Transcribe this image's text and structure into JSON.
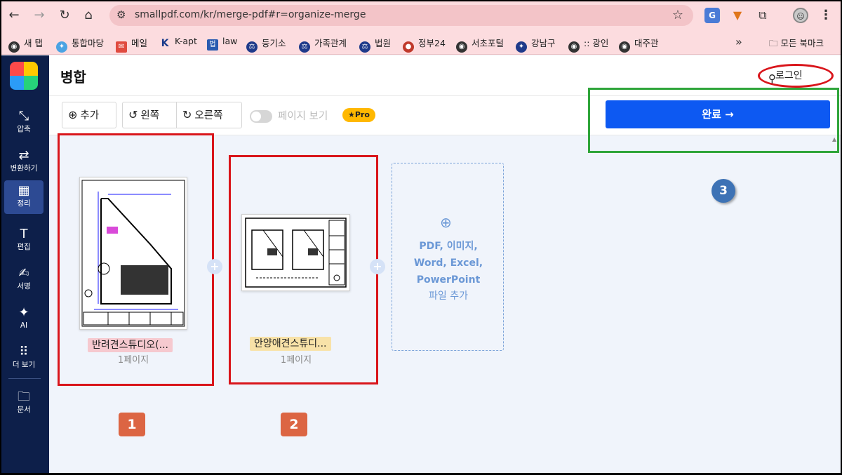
{
  "browser": {
    "url": "smallpdf.com/kr/merge-pdf#r=organize-merge",
    "bookmarks": [
      "새 탭",
      "통합마당",
      "메일",
      "K-apt",
      "law",
      "등기소",
      "가족관계",
      "법원",
      "정부24",
      "서초포털",
      "강남구",
      ":: 광인",
      "대주관"
    ],
    "bookmarks_folder": "모든 북마크"
  },
  "sidebar": {
    "items": [
      {
        "label": "압축",
        "icon": "compress-icon"
      },
      {
        "label": "변환하기",
        "icon": "convert-icon"
      },
      {
        "label": "정리",
        "icon": "organize-icon"
      },
      {
        "label": "편집",
        "icon": "edit-icon"
      },
      {
        "label": "서명",
        "icon": "sign-icon"
      },
      {
        "label": "AI",
        "icon": "ai-sparkle-icon"
      },
      {
        "label": "더 보기",
        "icon": "more-grid-icon"
      },
      {
        "label": "문서",
        "icon": "folder-icon"
      }
    ]
  },
  "header": {
    "title": "병합",
    "login_label": "로그인"
  },
  "toolbar": {
    "add_label": "추가",
    "rotate_left_label": "왼쪽",
    "rotate_right_label": "오른쪽",
    "page_view_label": "페이지 보기",
    "pro_badge": "Pro",
    "done_label": "완료 →"
  },
  "files": [
    {
      "name": "반려견스튜디오(...",
      "pages": "1페이지",
      "tag_color": "#f6c9cf"
    },
    {
      "name": "안양애견스튜디...",
      "pages": "1페이지",
      "tag_color": "#f8e2a8"
    }
  ],
  "add_zone": {
    "types_line1": "PDF, 이미지,",
    "types_line2": "Word, Excel,",
    "types_line3": "PowerPoint",
    "add_label": "파일 추가"
  },
  "annotations": {
    "badge1": "1",
    "badge2": "2",
    "badge3": "3",
    "colors": {
      "red": "#d9151b",
      "green": "#2fa53a",
      "badge_orange": "#dc6543",
      "badge_blue": "#3d72b5"
    }
  }
}
